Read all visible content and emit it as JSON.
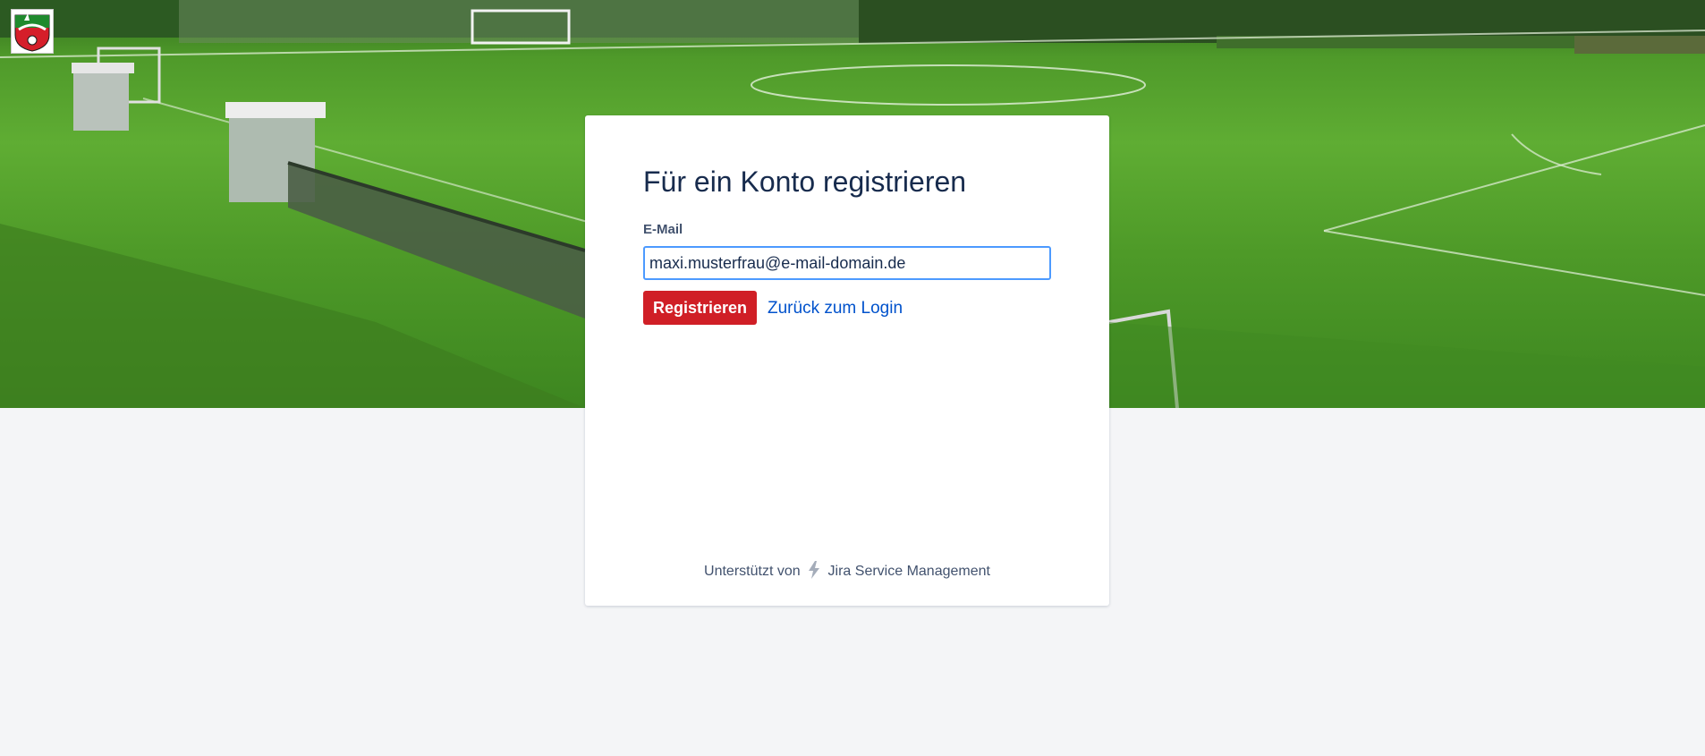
{
  "hero": {
    "background": "football pitch photo"
  },
  "logo": {
    "name": "club-crest",
    "colors": {
      "green": "#1f8a2e",
      "red": "#d51e2a",
      "white": "#ffffff"
    }
  },
  "form": {
    "title": "Für ein Konto registrieren",
    "email_label": "E-Mail",
    "email_value": "maxi.musterfrau@e-mail-domain.de",
    "register_label": "Registrieren",
    "back_link": "Zurück zum Login"
  },
  "footer": {
    "prefix": "Unterstützt von",
    "product": "Jira Service Management",
    "icon": "jira-bolt-icon"
  },
  "colors": {
    "primary_button": "#d01f26",
    "link": "#0052cc",
    "input_focus_border": "#4c9aff",
    "page_background": "#f4f5f7",
    "title_text": "#172b4d"
  }
}
